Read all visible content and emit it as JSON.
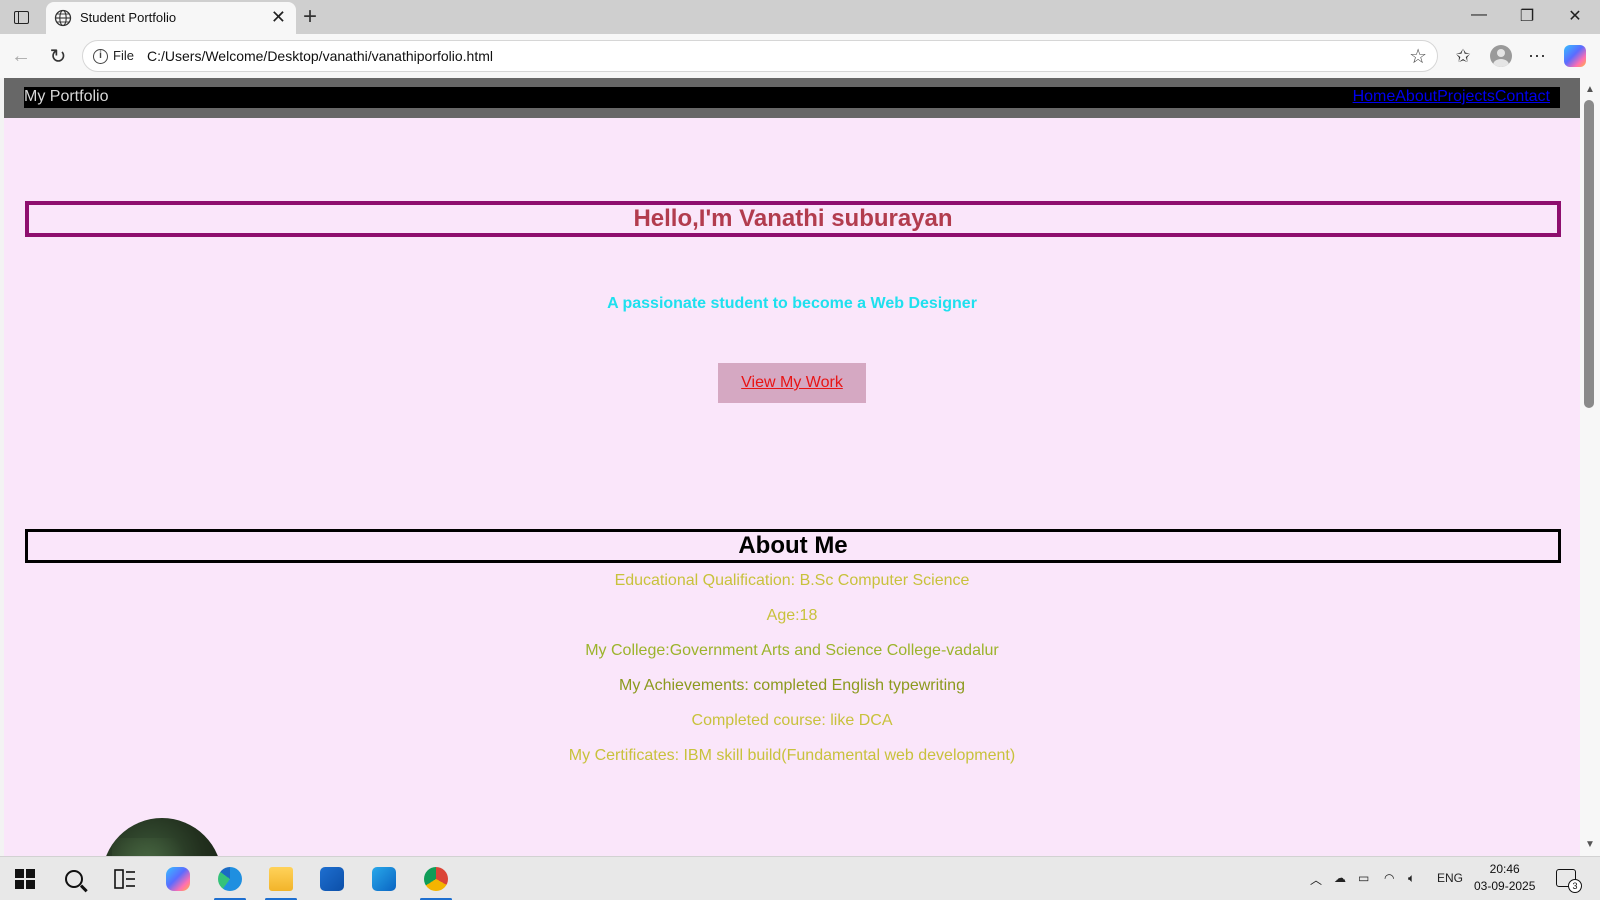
{
  "browser": {
    "tab_title": "Student Portfolio",
    "file_label": "File",
    "url": "C:/Users/Welcome/Desktop/vanathi/vanathiporfolio.html"
  },
  "site": {
    "brand": "My Portfolio",
    "nav": [
      "Home",
      "About",
      "Projects",
      "Contact"
    ],
    "hero_title": "Hello,I'm Vanathi suburayan",
    "tagline": "A passionate student to become a Web Designer",
    "cta_label": "View My Work",
    "about_title": "About Me",
    "about_lines": [
      {
        "text": "Educational Qualification: B.Sc Computer Science",
        "color": "#c8c23c"
      },
      {
        "text": "Age:18",
        "color": "#c8c23c"
      },
      {
        "text": "My College:Government Arts and Science College-vadalur",
        "color": "#9cb42c"
      },
      {
        "text": "My Achievements: completed English typewriting",
        "color": "#8c9a1e"
      },
      {
        "text": "Completed course: like DCA",
        "color": "#c8c23c"
      },
      {
        "text": "My Certificates: IBM skill build(Fundamental web development)",
        "color": "#c8c23c"
      }
    ]
  },
  "taskbar": {
    "language": "ENG",
    "time": "20:46",
    "date": "03-09-2025",
    "notification_count": "3"
  },
  "colors": {
    "page_bg": "#fae6fa",
    "hero_border": "#8e0e6e",
    "hero_text": "#b23c4e",
    "tagline": "#1ee0ee",
    "cta_bg": "#d5a8c2",
    "cta_text": "#e81414",
    "nav_link": "#0000ee"
  }
}
